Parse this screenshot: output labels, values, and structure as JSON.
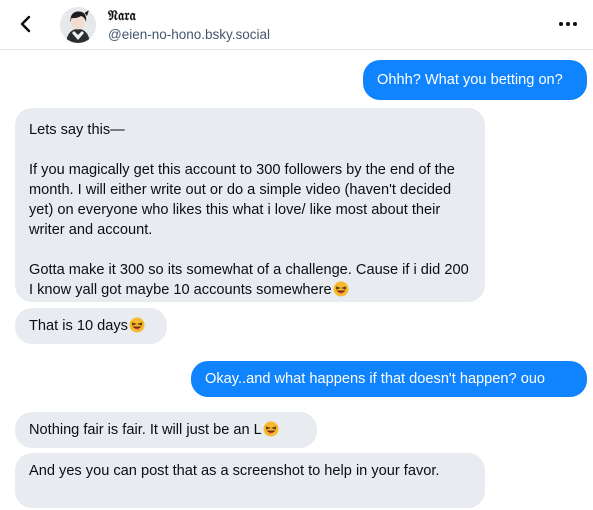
{
  "header": {
    "display_name": "𝔑𝔞𝔯𝔞",
    "handle": "@eien-no-hono.bsky.social"
  },
  "icons": {
    "back": "chevron-left-icon",
    "more": "ellipsis-icon",
    "emoji": "laughing-face-with-tongue-emoji"
  },
  "colors": {
    "sent_bubble": "#1083fe",
    "received_bubble": "#e8ecf0",
    "header_border": "#e3e8ed"
  },
  "messages": [
    {
      "direction": "sent",
      "text": "Ohhh? What you betting on?"
    },
    {
      "direction": "received",
      "text": "Lets say this—\n\nIf you magically get this account to 300 followers by the end of the month. I will either write out or do a simple video (haven't decided yet) on everyone who likes this what i love/ like most about their writer and account.\n\nGotta make it 300 so its somewhat of a challenge. Cause if i did 200 I know yall got maybe 10 accounts somewhere"
    },
    {
      "direction": "received",
      "text": "That is 10 days"
    },
    {
      "direction": "sent",
      "text": "Okay..and what happens if that doesn't happen? ouo"
    },
    {
      "direction": "received",
      "text": "Nothing fair is fair. It will just be an L"
    },
    {
      "direction": "received",
      "text": "And yes you can post that as a screenshot to help in your favor."
    }
  ]
}
